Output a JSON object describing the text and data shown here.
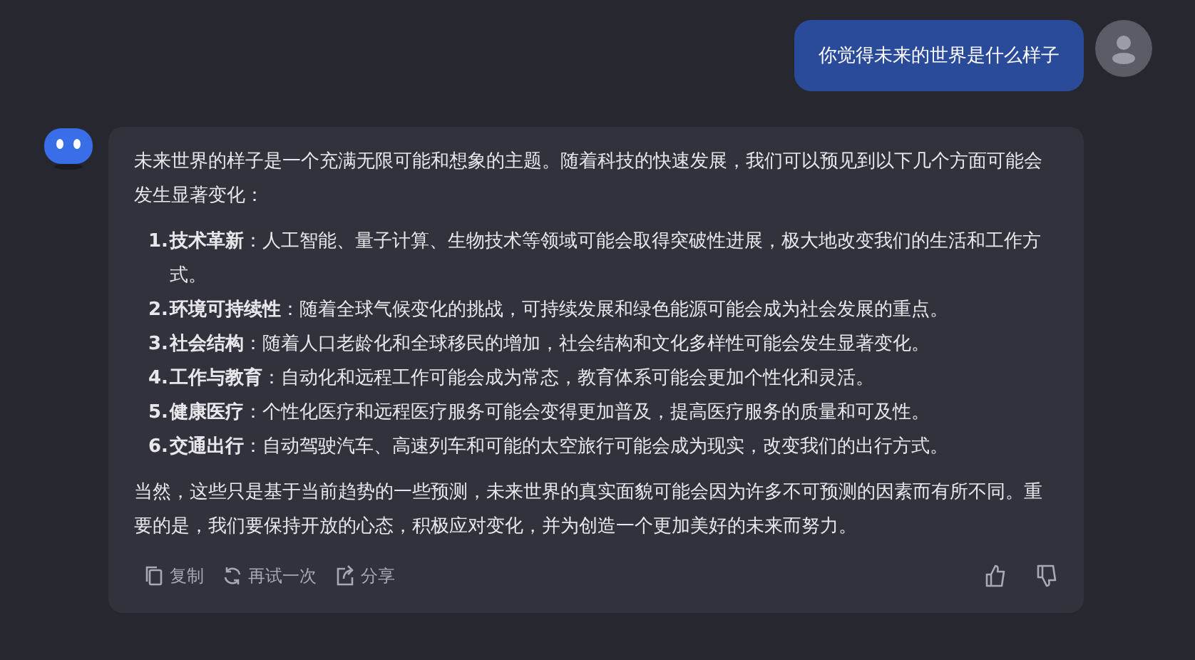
{
  "user_message": {
    "text": "你觉得未来的世界是什么样子"
  },
  "bot_message": {
    "intro": "未来世界的样子是一个充满无限可能和想象的主题。随着科技的快速发展，我们可以预见到以下几个方面可能会发生显著变化：",
    "items": [
      {
        "number": "1.",
        "text": "**技术革新**：人工智能、量子计算、生物技术等领域可能会取得突破性进展，极大地改变我们的生活和工作方式。"
      },
      {
        "number": "2.",
        "text": "**环境可持续性**：随着全球气候变化的挑战，可持续发展和绿色能源可能会成为社会发展的重点。"
      },
      {
        "number": "3.",
        "text": "**社会结构**：随着人口老龄化和全球移民的增加，社会结构和文化多样性可能会发生显著变化。"
      },
      {
        "number": "4.",
        "text": "**工作与教育**：自动化和远程工作可能会成为常态，教育体系可能会更加个性化和灵活。"
      },
      {
        "number": "5.",
        "text": "**健康医疗**：个性化医疗和远程医疗服务可能会变得更加普及，提高医疗服务的质量和可及性。"
      },
      {
        "number": "6.",
        "text": "**交通出行**：自动驾驶汽车、高速列车和可能的太空旅行可能会成为现实，改变我们的出行方式。"
      }
    ],
    "conclusion": "当然，这些只是基于当前趋势的一些预测，未来世界的真实面貌可能会因为许多不可预测的因素而有所不同。重要的是，我们要保持开放的心态，积极应对变化，并为创造一个更加美好的未来而努力。",
    "actions": [
      {
        "kind": "copy",
        "label": "复制"
      },
      {
        "kind": "retry",
        "label": "再试一次"
      },
      {
        "kind": "share",
        "label": "分享"
      }
    ],
    "feedback": [
      {
        "kind": "like"
      },
      {
        "kind": "dislike"
      }
    ]
  }
}
